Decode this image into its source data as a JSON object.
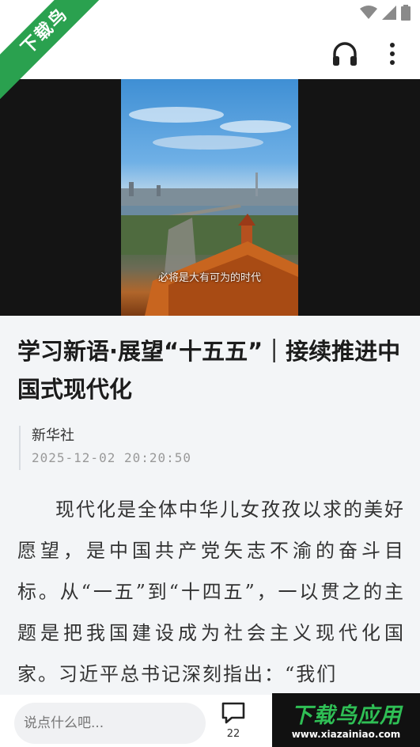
{
  "watermark": {
    "ribbon_text": "下载鸟",
    "logo_text": "下载鸟应用",
    "logo_url": "www.xiazainiao.com"
  },
  "icons": {
    "back": "back-arrow-icon",
    "audio": "headphones-icon",
    "more": "more-vertical-icon",
    "comment": "comment-bubble-icon"
  },
  "video": {
    "caption": "必将是大有可为的时代"
  },
  "article": {
    "title": "学习新语·展望“十五五”｜接续推进中国式现代化",
    "source": "新华社",
    "datetime": "2025-12-02 20:20:50",
    "body": "现代化是全体中华儿女孜孜以求的美好愿望，是中国共产党矢志不渝的奋斗目标。从“一五”到“十四五”，一以贯之的主题是把我国建设成为社会主义现代化国家。习近平总书记深刻指出：“我们"
  },
  "bottom_bar": {
    "comment_placeholder": "说点什么吧...",
    "comment_count": "22"
  },
  "colors": {
    "watermark_green": "#2aa14f",
    "background": "#f3f5f7"
  }
}
